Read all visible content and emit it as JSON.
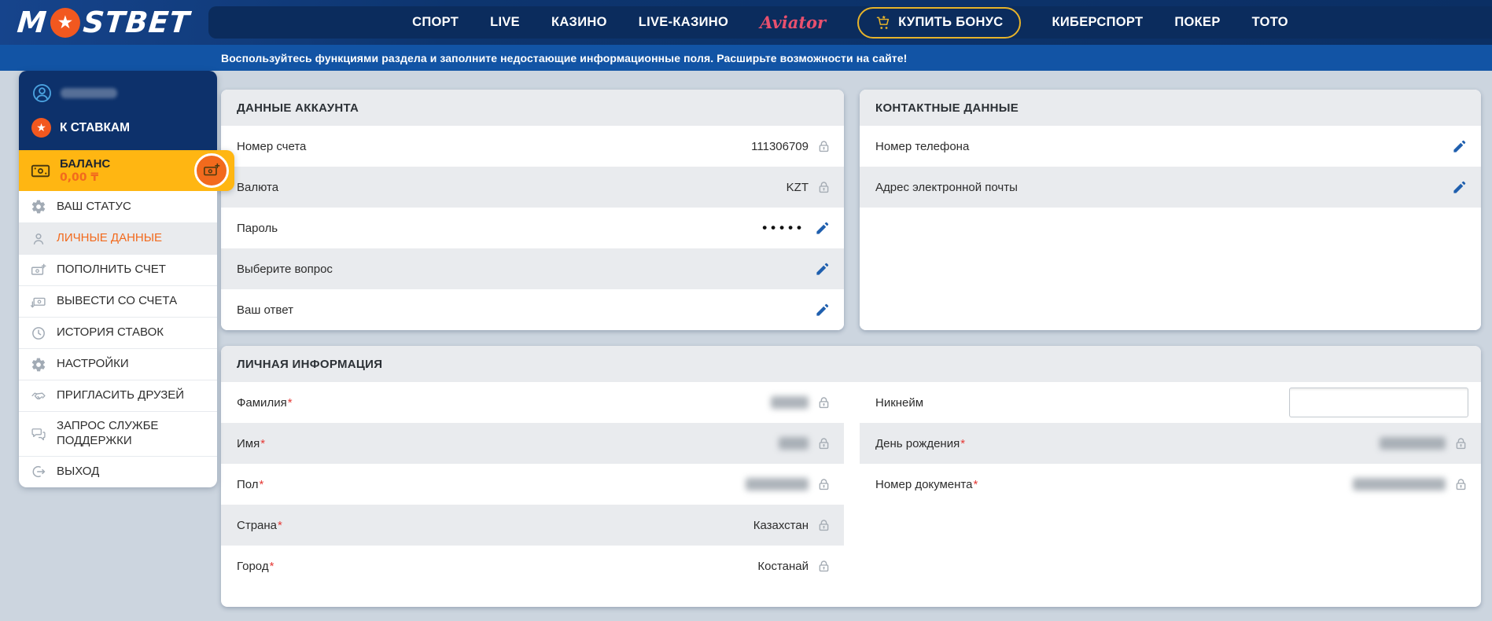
{
  "required_mark": "*",
  "icons": {
    "star": "★",
    "password_dots": "•••••"
  },
  "colors": {
    "nav_navy": "#0c3268",
    "notice_blue": "#1254a5",
    "accent_orange": "#f26a1d",
    "balance_yellow": "#ffb612",
    "bonus_gold": "#e7b32a",
    "aviator_pink": "#e8506e",
    "edit_blue": "#1f5fae",
    "panel_stripe": "#e9ebee"
  },
  "header": {
    "logo_prefix": "M",
    "logo_suffix": "STBET",
    "nav": [
      "СПОРТ",
      "LIVE",
      "КАЗИНО",
      "LIVE-КАЗИНО"
    ],
    "aviator_label": "Aviator",
    "buy_bonus_label": "КУПИТЬ БОНУС",
    "nav_right": [
      "КИБЕРСПОРТ",
      "ПОКЕР",
      "ТОТО"
    ],
    "notice": "Воспользуйтесь функциями раздела и заполните недостающие информационные поля. Расширьте возможности на сайте!"
  },
  "sidebar": {
    "to_bets_label": "К СТАВКАМ",
    "balance_label": "БАЛАНС",
    "balance_amount": "0,00 ₸",
    "active_item": "ЛИЧНЫЕ ДАННЫЕ",
    "items": [
      {
        "label": "ВАШ СТАТУС"
      },
      {
        "label": "ЛИЧНЫЕ ДАННЫЕ"
      },
      {
        "label": "ПОПОЛНИТЬ СЧЕТ"
      },
      {
        "label": "ВЫВЕСТИ СО СЧЕТА"
      },
      {
        "label": "ИСТОРИЯ СТАВОК"
      },
      {
        "label": "НАСТРОЙКИ"
      },
      {
        "label": "ПРИГЛАСИТЬ ДРУЗЕЙ"
      },
      {
        "label": "ЗАПРОС СЛУЖБЕ ПОДДЕРЖКИ"
      },
      {
        "label": "ВЫХОД"
      }
    ]
  },
  "account_panel": {
    "title": "ДАННЫЕ АККАУНТА",
    "rows": [
      {
        "label": "Номер счета",
        "value": "111306709",
        "locked": true
      },
      {
        "label": "Валюта",
        "value": "KZT",
        "locked": true
      },
      {
        "label": "Пароль",
        "value": "•••••",
        "editable": true
      },
      {
        "label": "Выберите вопрос",
        "value": "",
        "editable": true
      },
      {
        "label": "Ваш ответ",
        "value": "",
        "editable": true
      }
    ]
  },
  "contact_panel": {
    "title": "КОНТАКТНЫЕ ДАННЫЕ",
    "rows": [
      {
        "label": "Номер телефона",
        "editable": true
      },
      {
        "label": "Адрес электронной почты",
        "editable": true
      }
    ]
  },
  "personal_panel": {
    "title": "ЛИЧНАЯ ИНФОРМАЦИЯ",
    "left_rows": [
      {
        "label": "Фамилия",
        "required": true,
        "redacted": true,
        "locked": true
      },
      {
        "label": "Имя",
        "required": true,
        "redacted": true,
        "locked": true
      },
      {
        "label": "Пол",
        "required": true,
        "redacted": true,
        "locked": true
      },
      {
        "label": "Страна",
        "required": true,
        "value": "Казахстан",
        "locked": true
      },
      {
        "label": "Город",
        "required": true,
        "value": "Костанай",
        "locked": true
      }
    ],
    "right_rows": [
      {
        "label": "Никнейм",
        "input_value": ""
      },
      {
        "label": "День рождения",
        "required": true,
        "redacted": true,
        "locked": true
      },
      {
        "label": "Номер документа",
        "required": true,
        "redacted": true,
        "locked": true
      }
    ]
  }
}
